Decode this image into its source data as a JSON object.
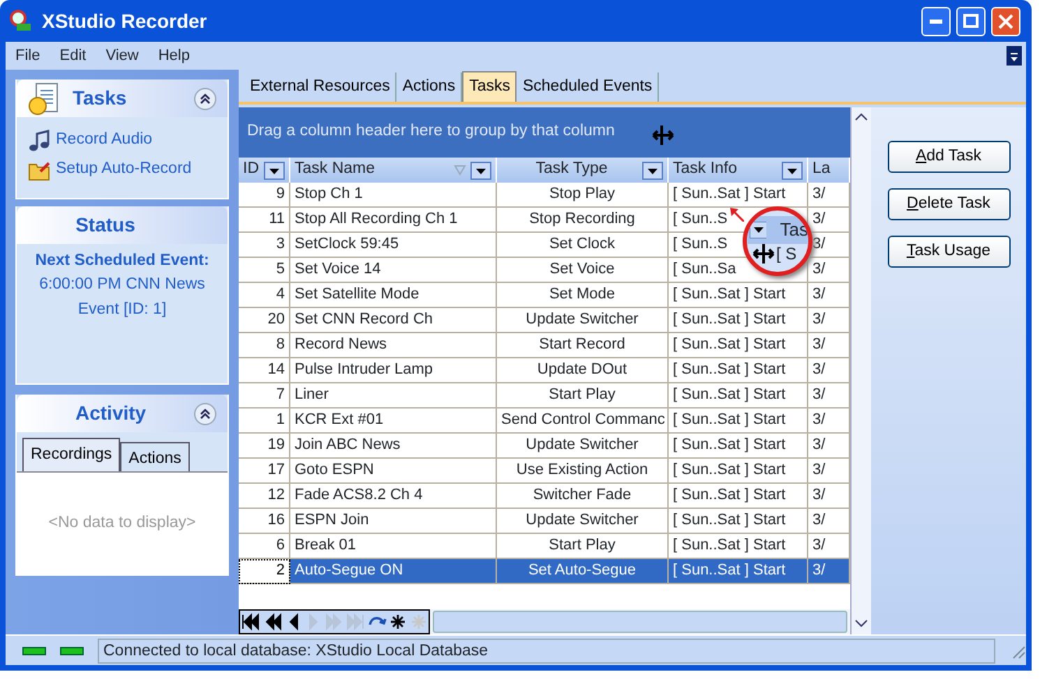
{
  "window": {
    "title": "XStudio Recorder"
  },
  "menu": [
    "File",
    "Edit",
    "View",
    "Help"
  ],
  "tasks_panel": {
    "title": "Tasks",
    "items": [
      "Record Audio",
      "Setup Auto-Record"
    ]
  },
  "status_panel": {
    "title": "Status",
    "heading": "Next Scheduled Event:",
    "event": "6:00:00 PM CNN News Event [ID: 1]"
  },
  "activity_panel": {
    "title": "Activity",
    "tabs": [
      {
        "label": "Recordings",
        "selected": true
      },
      {
        "label": "Actions",
        "selected": false
      }
    ],
    "empty_text": "<No data to display>"
  },
  "tabs": [
    {
      "label": "External Resources",
      "selected": false
    },
    {
      "label": "Actions",
      "selected": false
    },
    {
      "label": "Tasks",
      "selected": true
    },
    {
      "label": "Scheduled Events",
      "selected": false
    }
  ],
  "group_hint": "Drag a column header here to group by that column",
  "table": {
    "columns": [
      "ID",
      "Task Name",
      "Task Type",
      "Task Info",
      "La"
    ],
    "rows": [
      {
        "cells": [
          "9",
          "Stop Ch 1",
          "Stop Play",
          "[ Sun..Sat ] Start",
          "3/"
        ],
        "selected": false
      },
      {
        "cells": [
          "11",
          "Stop All Recording Ch 1",
          "Stop Recording",
          "[ Sun..S",
          "3/"
        ],
        "selected": false
      },
      {
        "cells": [
          "3",
          "SetClock 59:45",
          "Set Clock",
          "[ Sun..S",
          "3/"
        ],
        "selected": false
      },
      {
        "cells": [
          "5",
          "Set Voice 14",
          "Set Voice",
          "[ Sun..Sa",
          "3/"
        ],
        "selected": false
      },
      {
        "cells": [
          "4",
          "Set Satellite Mode",
          "Set Mode",
          "[ Sun..Sat ] Start",
          "3/"
        ],
        "selected": false
      },
      {
        "cells": [
          "20",
          "Set CNN Record Ch",
          "Update Switcher",
          "[ Sun..Sat ] Start",
          "3/"
        ],
        "selected": false
      },
      {
        "cells": [
          "8",
          "Record News",
          "Start Record",
          "[ Sun..Sat ] Start",
          "3/"
        ],
        "selected": false
      },
      {
        "cells": [
          "14",
          "Pulse Intruder Lamp",
          "Update DOut",
          "[ Sun..Sat ] Start",
          "3/"
        ],
        "selected": false
      },
      {
        "cells": [
          "7",
          "Liner",
          "Start Play",
          "[ Sun..Sat ] Start",
          "3/"
        ],
        "selected": false
      },
      {
        "cells": [
          "1",
          "KCR Ext #01",
          "Send Control Commanc",
          "[ Sun..Sat ] Start",
          "3/"
        ],
        "selected": false
      },
      {
        "cells": [
          "19",
          "Join ABC News",
          "Update Switcher",
          "[ Sun..Sat ] Start",
          "3/"
        ],
        "selected": false
      },
      {
        "cells": [
          "17",
          "Goto ESPN",
          "Use Existing Action",
          "[ Sun..Sat ] Start",
          "3/"
        ],
        "selected": false
      },
      {
        "cells": [
          "12",
          "Fade ACS8.2 Ch 4",
          "Switcher Fade",
          "[ Sun..Sat ] Start",
          "3/"
        ],
        "selected": false
      },
      {
        "cells": [
          "16",
          "ESPN Join",
          "Update Switcher",
          "[ Sun..Sat ] Start",
          "3/"
        ],
        "selected": false
      },
      {
        "cells": [
          "6",
          "Break 01",
          "Start Play",
          "[ Sun..Sat ] Start",
          "3/"
        ],
        "selected": false
      },
      {
        "cells": [
          "2",
          "Auto-Segue ON",
          "Set Auto-Segue",
          "[ Sun..Sat ] Start",
          "3/"
        ],
        "selected": true
      }
    ]
  },
  "magnifier": {
    "header": "Tas",
    "cell": "[ S"
  },
  "buttons": [
    "Add Task",
    "Delete Task",
    "Task Usage"
  ],
  "status_bar": {
    "text": "Connected to local database: XStudio Local Database"
  }
}
